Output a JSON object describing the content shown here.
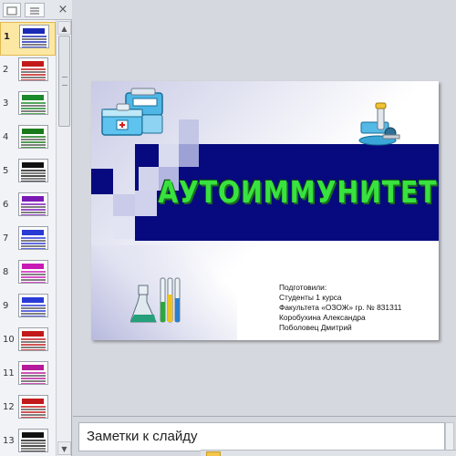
{
  "thumbnail_pane": {
    "close_glyph": "×",
    "active_slide": 1,
    "slides": [
      {
        "number": "1",
        "accent": "#1a2ab5"
      },
      {
        "number": "2",
        "accent": "#c21a1a"
      },
      {
        "number": "3",
        "accent": "#1a8a2a"
      },
      {
        "number": "4",
        "accent": "#1a7a1a"
      },
      {
        "number": "5",
        "accent": "#111111"
      },
      {
        "number": "6",
        "accent": "#7a1ab5"
      },
      {
        "number": "7",
        "accent": "#2a3ad5"
      },
      {
        "number": "8",
        "accent": "#c81ab5"
      },
      {
        "number": "9",
        "accent": "#2a3ad5"
      },
      {
        "number": "10",
        "accent": "#c21a1a"
      },
      {
        "number": "11",
        "accent": "#b51a9a"
      },
      {
        "number": "12",
        "accent": "#c21a1a"
      },
      {
        "number": "13",
        "accent": "#111111"
      }
    ]
  },
  "slide": {
    "title": "АУТОИММУНИТЕТ",
    "subtitle_lines": [
      "Подготовили:",
      "Студенты 1 курса",
      "Факультета «ОЗОЖ» гр. № 831311",
      "Коробухина Александра",
      "Поболовец Дмитрий"
    ],
    "colors": {
      "title_band": "#070a7e",
      "title_text": "#38e23f"
    }
  },
  "notes": {
    "placeholder": "Заметки к слайду"
  },
  "icons": {
    "tab_slides": "slides-tab-icon",
    "tab_outline": "outline-tab-icon",
    "close": "close-icon",
    "scroll_up": "scroll-up-icon",
    "scroll_down": "scroll-down-icon"
  }
}
